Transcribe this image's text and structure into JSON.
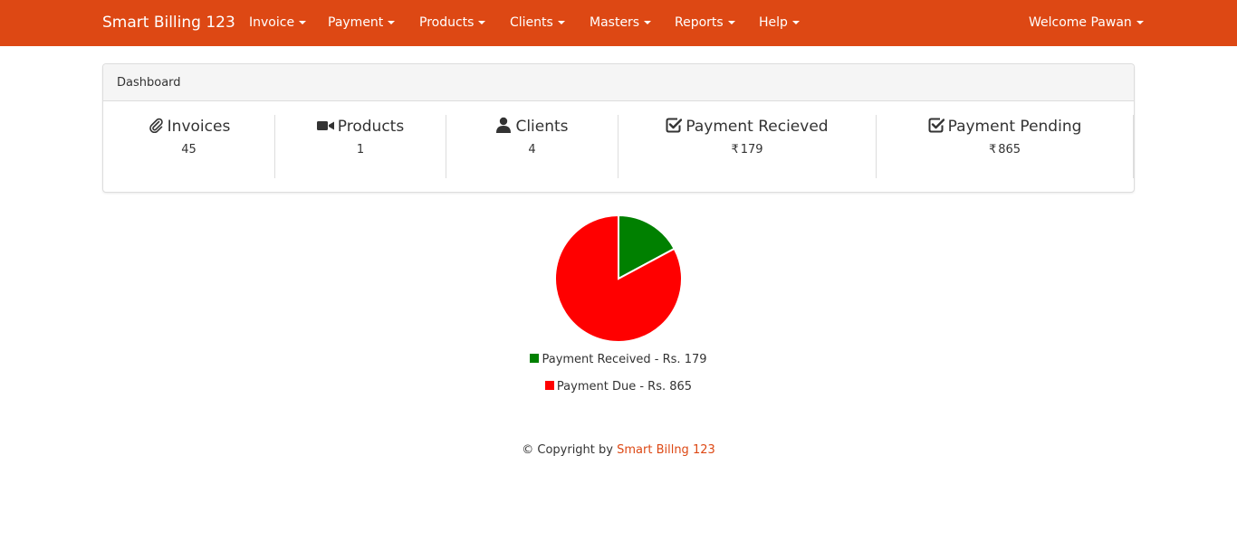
{
  "navbar": {
    "brand": "Smart Billing 123",
    "menus": [
      "Invoice",
      "Payment",
      "Products",
      "Clients",
      "Masters",
      "Reports",
      "Help"
    ],
    "user": "Welcome Pawan"
  },
  "colors": {
    "navbar": "#dd4814",
    "received": "#008000",
    "due": "#ff0000",
    "link": "#dd4814"
  },
  "dashboard": {
    "heading": "Dashboard",
    "stats": [
      {
        "icon": "paperclip-icon",
        "label": "Invoices",
        "value": "45"
      },
      {
        "icon": "video-camera-icon",
        "label": "Products",
        "value": "1"
      },
      {
        "icon": "user-icon",
        "label": "Clients",
        "value": "4"
      },
      {
        "icon": "check-square-icon",
        "label": "Payment Recieved",
        "currency": "₹",
        "value": "179"
      },
      {
        "icon": "check-square-icon",
        "label": "Payment Pending",
        "currency": "₹",
        "value": "865"
      }
    ]
  },
  "chart_data": {
    "type": "pie",
    "title": "",
    "categories": [
      "Payment Received",
      "Payment Due"
    ],
    "values": [
      179,
      865
    ],
    "colors": [
      "#008000",
      "#ff0000"
    ],
    "legend": [
      "Payment Received - Rs. 179",
      "Payment Due - Rs. 865"
    ],
    "legend_placement": "bottom"
  },
  "footer": {
    "prefix": "© Copyright by",
    "link": "Smart Billng 123"
  }
}
